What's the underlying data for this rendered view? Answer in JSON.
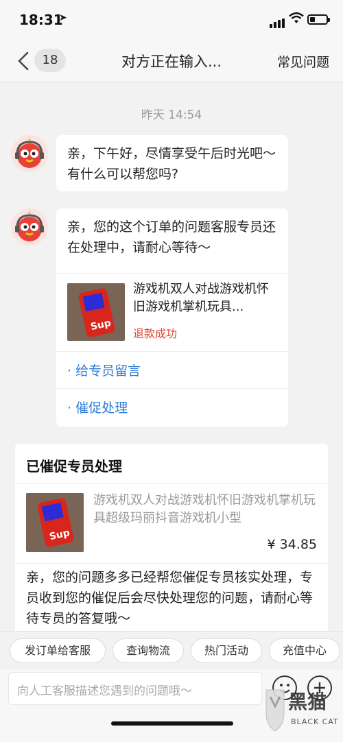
{
  "status_bar": {
    "time": "18:31",
    "location_glyph": "➤"
  },
  "nav": {
    "unread_count": "18",
    "title": "对方正在输入...",
    "faq_label": "常见问题"
  },
  "chat": {
    "timestamp": "昨天 14:54",
    "greeting": "亲，下午好，尽情享受午后时光吧～有什么可以帮您吗?",
    "order_message": {
      "text": "亲，您的这个订单的问题客服专员还在处理中，请耐心等待～",
      "product_title": "游戏机双人对战游戏机怀旧游戏机掌机玩具...",
      "status": "退款成功",
      "actions": [
        "· 给专员留言",
        "· 催促处理"
      ]
    },
    "urge_card": {
      "title": "已催促专员处理",
      "product_title": "游戏机双人对战游戏机怀旧游戏机掌机玩具超级玛丽抖音游戏机小型",
      "price": "¥ 34.85",
      "message": "亲，您的问题多多已经帮您催促专员核实处理，专员收到您的催促后会尽快处理您的问题，请耐心等待专员的答复哦～"
    }
  },
  "quick_actions": [
    "发订单给客服",
    "查询物流",
    "热门活动",
    "充值中心"
  ],
  "input": {
    "placeholder": "向人工客服描述您遇到的问题哦～"
  },
  "watermark": {
    "brand": "黑猫",
    "sub": "BLACK CAT"
  },
  "colors": {
    "link_blue": "#2d7ed6",
    "status_red": "#e0452e",
    "background": "#f2f2f2"
  },
  "icons": [
    "back-chevron-icon",
    "emoji-icon",
    "plus-icon",
    "signal-icon",
    "wifi-icon",
    "battery-icon"
  ]
}
